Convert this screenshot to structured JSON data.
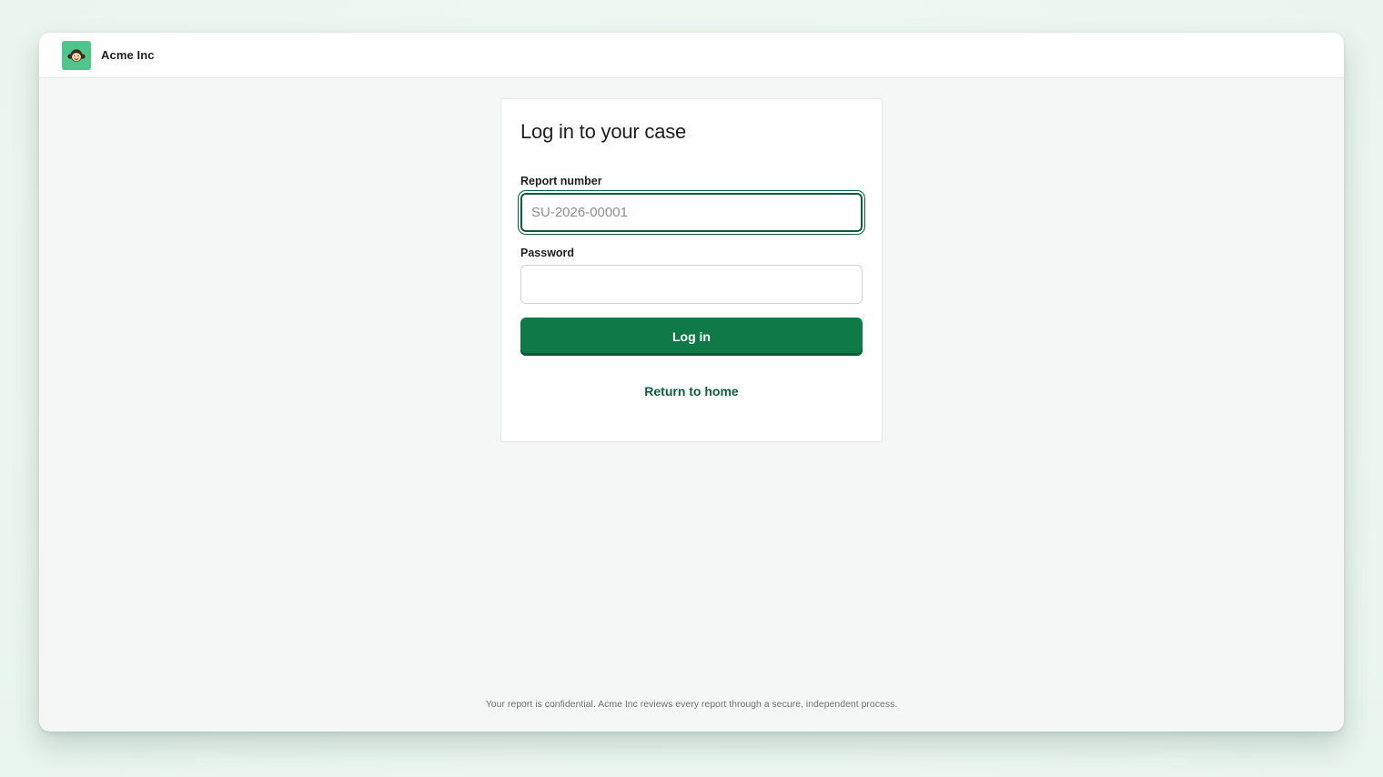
{
  "header": {
    "brand_name": "Acme Inc",
    "logo_icon": "monkey-face-icon"
  },
  "login_card": {
    "title": "Log in to your case",
    "report_number": {
      "label": "Report number",
      "placeholder": "SU-2026-00001",
      "value": ""
    },
    "password": {
      "label": "Password",
      "value": ""
    },
    "submit_label": "Log in",
    "return_link_label": "Return to home"
  },
  "footer": {
    "note": "Your report is confidential. Acme Inc reviews every report through a secure, independent process."
  },
  "colors": {
    "accent": "#0f7a47",
    "focus_ring": "#0d5e3a",
    "logo_bg": "#4fc48b",
    "background": "#eef7f2"
  }
}
